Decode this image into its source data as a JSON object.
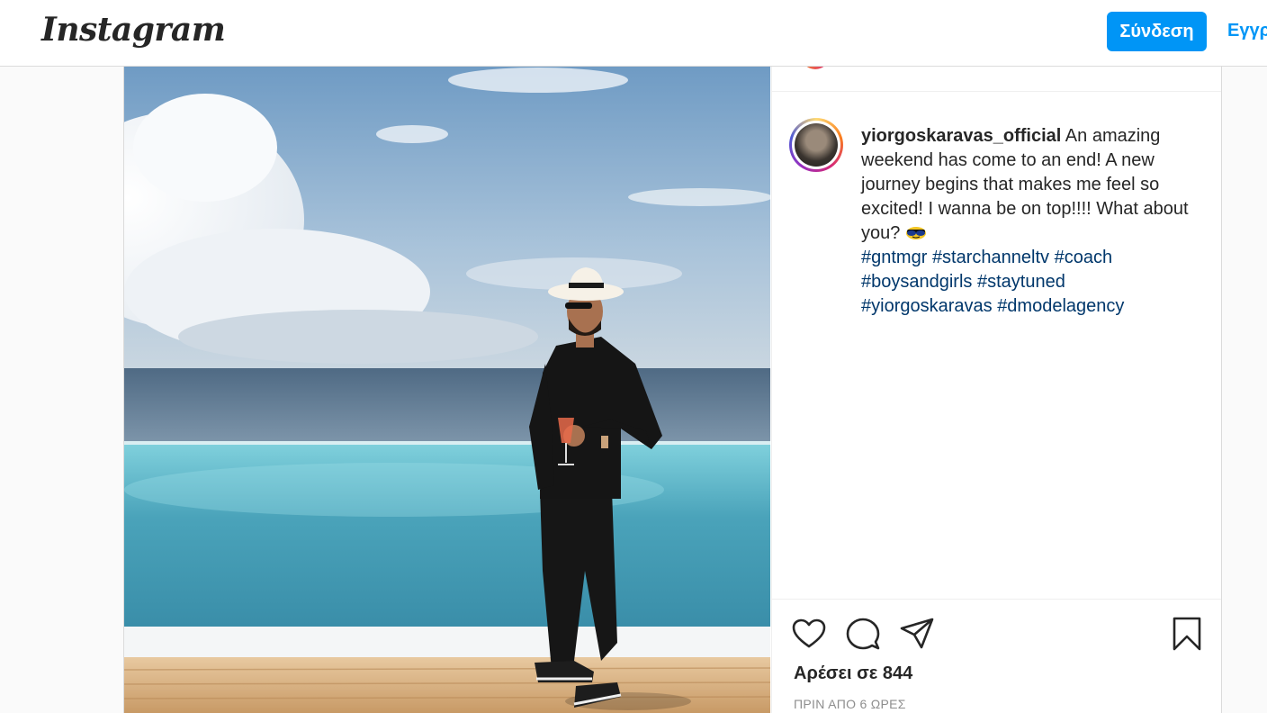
{
  "nav": {
    "logo": "Instagram",
    "login_label": "Σύνδεση",
    "signup_label": "Εγγρ"
  },
  "post": {
    "username": "yiorgoskaravas_official",
    "caption": "An amazing weekend has come to an end! A new journey begins that makes me feel so excited! I wanna be on top!!!! What about you?",
    "hashtags": [
      "#gntmgr",
      "#starchanneltv",
      "#coach",
      "#boysandgirls",
      "#staytuned",
      "#yiorgoskaravas",
      "#dmodelagency"
    ],
    "likes_text": "Αρέσει σε 844",
    "timestamp": "ΠΡΙΝ ΑΠΟ 6 ΩΡΕΣ"
  },
  "icons": {
    "like": "heart-icon",
    "comment": "comment-icon",
    "share": "share-icon",
    "save": "bookmark-icon"
  },
  "colors": {
    "accent": "#0095f6",
    "hashtag": "#00376b",
    "muted": "#8e8e8e"
  }
}
